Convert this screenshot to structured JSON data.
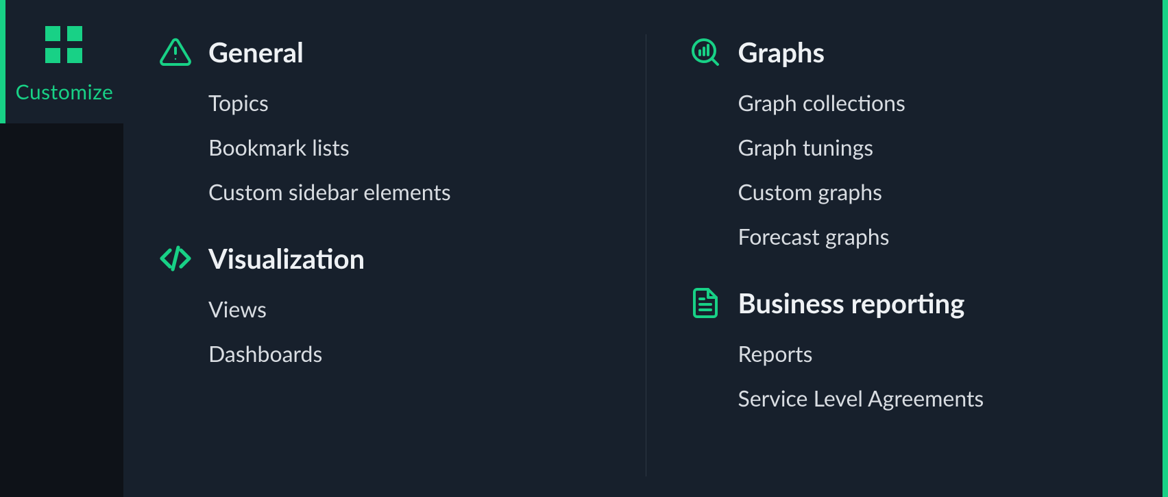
{
  "rail": {
    "label": "Customize"
  },
  "columns": {
    "left": {
      "groups": {
        "general": {
          "title": "General",
          "items": [
            "Topics",
            "Bookmark lists",
            "Custom sidebar elements"
          ]
        },
        "visualization": {
          "title": "Visualization",
          "items": [
            "Views",
            "Dashboards"
          ]
        }
      }
    },
    "right": {
      "groups": {
        "graphs": {
          "title": "Graphs",
          "items": [
            "Graph collections",
            "Graph tunings",
            "Custom graphs",
            "Forecast graphs"
          ]
        },
        "business_reporting": {
          "title": "Business reporting",
          "items": [
            "Reports",
            "Service Level Agreements"
          ]
        }
      }
    }
  }
}
